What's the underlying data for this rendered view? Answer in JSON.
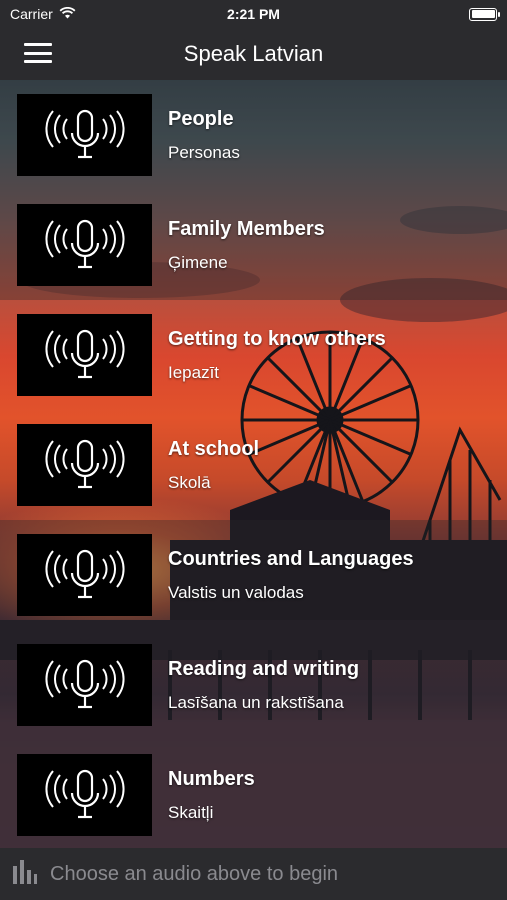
{
  "status_bar": {
    "carrier": "Carrier",
    "time": "2:21 PM"
  },
  "nav_bar": {
    "title": "Speak Latvian"
  },
  "lessons": [
    {
      "title": "People",
      "subtitle": "Personas"
    },
    {
      "title": "Family Members",
      "subtitle": "Ģimene"
    },
    {
      "title": "Getting to know others",
      "subtitle": "Iepazīt"
    },
    {
      "title": "At school",
      "subtitle": "Skolā"
    },
    {
      "title": "Countries and Languages",
      "subtitle": "Valstis un valodas"
    },
    {
      "title": "Reading and writing",
      "subtitle": "Lasīšana un rakstīšana"
    },
    {
      "title": "Numbers",
      "subtitle": "Skaitļi"
    }
  ],
  "player_bar": {
    "prompt": "Choose an audio above to begin"
  },
  "colors": {
    "bar_bg": "#2b2b2e",
    "thumb_bg": "#000000",
    "muted_text": "#8a8a8f"
  },
  "icons": {
    "thumbnail": "microphone-soundwave-icon",
    "menu": "hamburger-menu-icon",
    "player": "audio-bars-icon"
  }
}
